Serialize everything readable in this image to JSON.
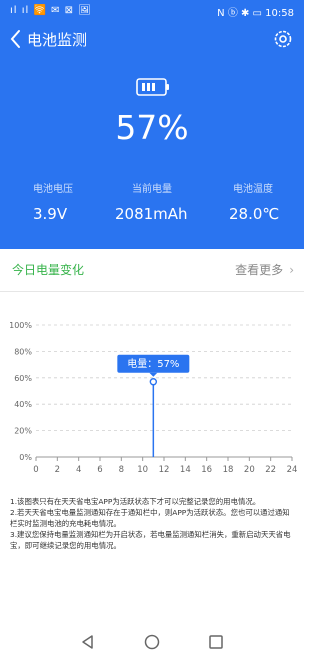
{
  "status": {
    "left": "ıl ıl 🛜 ✉ ⊠ 🖼",
    "right": "N ⓑ ✱ ▭ 10:58"
  },
  "header": {
    "title": "电池监测"
  },
  "battery": {
    "percent": "57%"
  },
  "stats": [
    {
      "label": "电池电压",
      "value": "3.9V"
    },
    {
      "label": "当前电量",
      "value": "2081mAh"
    },
    {
      "label": "电池温度",
      "value": "28.0℃"
    }
  ],
  "card": {
    "title": "今日电量变化",
    "more_label": "查看更多"
  },
  "colors": {
    "hero": "#2a74f0",
    "accent": "#36b34a",
    "line": "#2a74f0"
  },
  "icons": {
    "back": "chevron-left-icon",
    "settings": "gear-icon",
    "battery": "battery-icon"
  },
  "chart_data": {
    "type": "line",
    "x_ticks": [
      "0",
      "2",
      "4",
      "6",
      "8",
      "10",
      "12",
      "14",
      "16",
      "18",
      "20",
      "22",
      "24"
    ],
    "y_ticks": [
      "0%",
      "20%",
      "40%",
      "60%",
      "80%",
      "100%"
    ],
    "xlim": [
      0,
      24
    ],
    "ylim": [
      0,
      100
    ],
    "points": [
      {
        "x": 11,
        "y": 57
      }
    ],
    "tooltip": "电量：57%"
  },
  "notes": [
    "1.该图表只有在天天省电宝APP为活跃状态下才可以完整记录您的用电情况。",
    "2.若天天省电宝电量监测通知存在于通知栏中，则APP为活跃状态。您也可以通过通知栏实时监测电池的充电耗电情况。",
    "3.建议您保持电量监测通知栏为开启状态，若电量监测通知栏消失，重新启动天天省电宝，即可继续记录您的用电情况。"
  ]
}
